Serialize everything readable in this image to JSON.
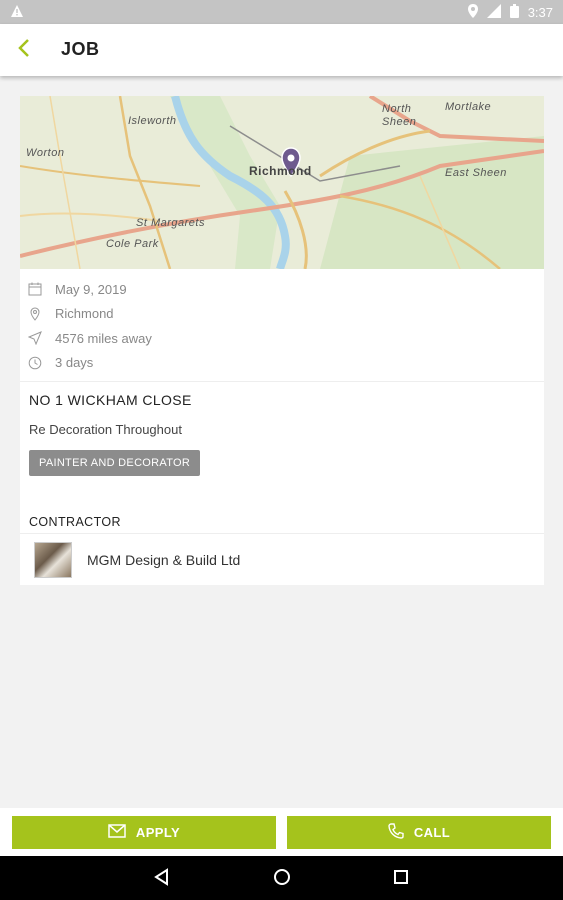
{
  "status_bar": {
    "time": "3:37"
  },
  "app_bar": {
    "title": "JOB"
  },
  "map": {
    "labels": [
      "Isleworth",
      "Worton",
      "North Sheen",
      "Mortlake",
      "Richmond",
      "East Sheen",
      "St Margarets",
      "Cole Park"
    ]
  },
  "meta": {
    "date": "May 9, 2019",
    "location": "Richmond",
    "distance": "4576 miles away",
    "duration": "3 days"
  },
  "job": {
    "title": "NO 1 WICKHAM CLOSE",
    "description": "Re Decoration Throughout",
    "tag": "PAINTER AND DECORATOR"
  },
  "contractor": {
    "heading": "CONTRACTOR",
    "name": "MGM Design & Build Ltd"
  },
  "actions": {
    "apply": "APPLY",
    "call": "CALL"
  },
  "colors": {
    "accent": "#a5c31c",
    "pin": "#6e5a8e"
  }
}
